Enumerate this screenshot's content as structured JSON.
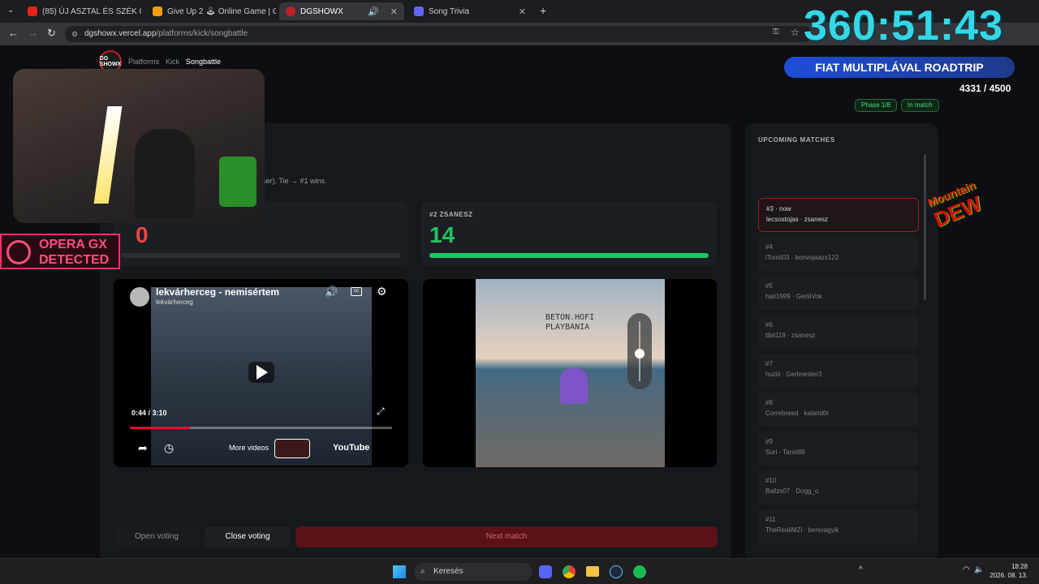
{
  "tabs": [
    {
      "label": "(85) ÚJ ASZTAL ÉS SZÉK ÖSSZER",
      "color": "#e62117"
    },
    {
      "label": "Give Up 2 🕹 Online Game | Ga",
      "color": "#f59e0b"
    },
    {
      "label": "DGSHOWX",
      "color": "#c0202a"
    },
    {
      "label": "Song Trivia",
      "color": "#6366f1"
    }
  ],
  "url": {
    "host": "dgshowx.vercel.app",
    "path": "/platforms/kick/songbattle"
  },
  "breadcrumb": {
    "logo": "DG SHOWX",
    "platforms": "Platforms",
    "kick": "Kick",
    "current": "Songbattle"
  },
  "status": {
    "phase": "Phase 1/8",
    "state": "In match"
  },
  "rule_text": "ser). Tie → #1 wins.",
  "player1": {
    "score": "0",
    "fill": 0.0
  },
  "player2": {
    "label": "#2 ZSANESZ",
    "score": "14",
    "fill": 1.0
  },
  "video_left": {
    "title": "lekvárherceg - nemisértem",
    "channel": "lekvárherceg",
    "time": "0:44 / 3:10",
    "more": "More videos",
    "brand": "YouTube",
    "progress": 0.23
  },
  "album": {
    "text_line1": "BETON.HOFI",
    "text_line2": "PLAYBANIA"
  },
  "volume_level": 0.45,
  "buttons": {
    "open": "Open voting",
    "close": "Close voting",
    "next": "Next match"
  },
  "sidebar": {
    "title": "UPCOMING MATCHES",
    "matches": [
      {
        "id": "#3 · now",
        "players": "lecsostojas · zsanesz"
      },
      {
        "id": "#4",
        "players": "iTomii03 · bonvojaazs122"
      },
      {
        "id": "#5",
        "players": "hati1999 · GerliiVok"
      },
      {
        "id": "#6",
        "players": "tibii119 · zsanesz"
      },
      {
        "id": "#7",
        "players": "huziii · Gerlmester3"
      },
      {
        "id": "#8",
        "players": "Correbreed · kaland0r"
      },
      {
        "id": "#9",
        "players": "Suri · Tarsii88"
      },
      {
        "id": "#10",
        "players": "Ballzs07 · Dogg_o"
      },
      {
        "id": "#11",
        "players": "TheRealiMZi · benivagyik"
      }
    ]
  },
  "overlay": {
    "timer": "360:51:43",
    "roadtrip": "FIAT MULTIPLÁVAL ROADTRIP",
    "progress": "4331 / 4500",
    "opera_line1": "OPERA GX",
    "opera_line2": "DETECTED",
    "dew_line1": "Mountain",
    "dew_line2": "DEW"
  },
  "taskbar": {
    "search": "Keresés",
    "time": "18:28",
    "date": "2026. 08. 13."
  }
}
